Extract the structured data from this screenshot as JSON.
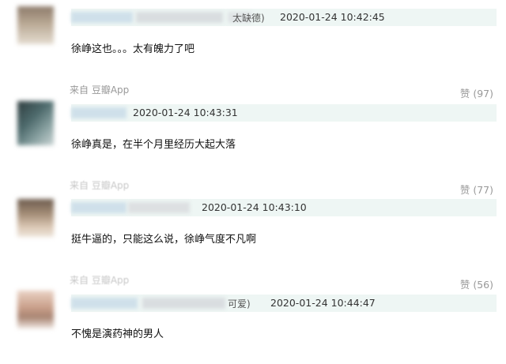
{
  "comments": [
    {
      "username_suffix": "太缺德)",
      "timestamp": "2020-01-24 10:42:45",
      "text": "徐峥这也。。。太有魄力了吧",
      "source": "来自 豆瓣App",
      "likes": "赞 (97)"
    },
    {
      "timestamp": "2020-01-24 10:43:31",
      "text": "徐峥真是，在半个月里经历大起大落",
      "source": "来自 豆瓣App",
      "likes": "赞 (77)"
    },
    {
      "timestamp": "2020-01-24 10:43:10",
      "text": "挺牛逼的，只能这么说，徐峥气度不凡啊",
      "source": "来自 豆瓣App",
      "likes": "赞 (56)"
    },
    {
      "username_suffix": "可爱)",
      "timestamp": "2020-01-24 10:44:47",
      "text": "不愧是演药神的男人"
    }
  ]
}
